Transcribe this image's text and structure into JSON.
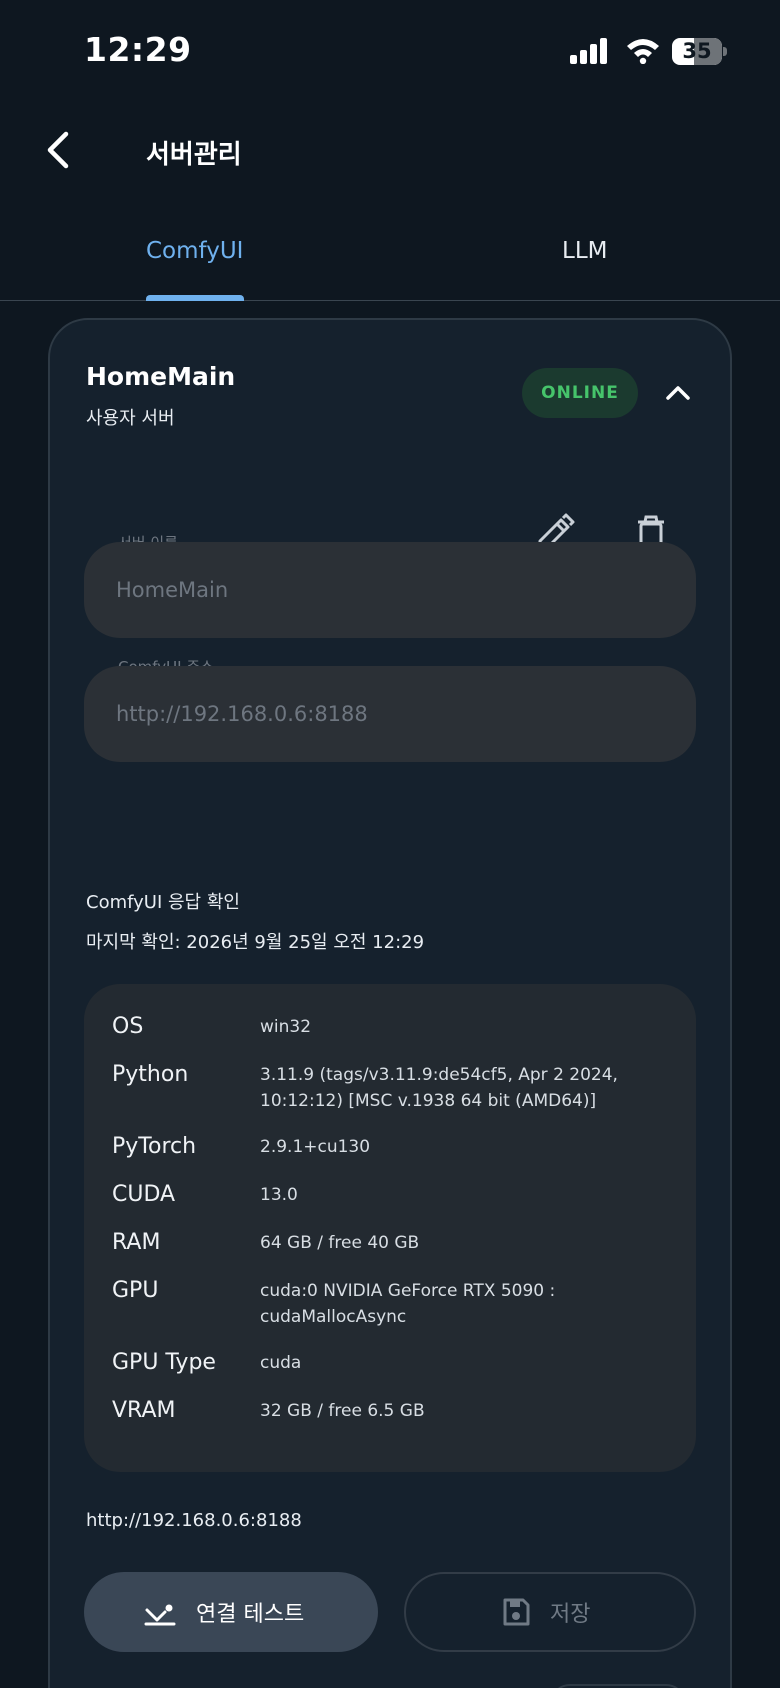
{
  "status_bar": {
    "time": "12:29",
    "battery": "35"
  },
  "header": {
    "title": "서버관리"
  },
  "tabs": [
    {
      "label": "ComfyUI",
      "active": true
    },
    {
      "label": "LLM",
      "active": false
    }
  ],
  "server": {
    "name": "HomeMain",
    "subtitle": "사용자 서버",
    "status": "ONLINE",
    "fields": {
      "name_label": "서버 이름",
      "name_value": "HomeMain",
      "url_label": "ComfyUI 주소",
      "url_value": "http://192.168.0.6:8188"
    },
    "check": {
      "title": "ComfyUI 응답 확인",
      "last_checked": "마지막 확인: 2026년 9월 25일 오전 12:29"
    },
    "info": [
      {
        "key": "OS",
        "value": "win32"
      },
      {
        "key": "Python",
        "value": "3.11.9 (tags/v3.11.9:de54cf5, Apr  2 2024, 10:12:12) [MSC v.1938 64 bit (AMD64)]"
      },
      {
        "key": "PyTorch",
        "value": "2.9.1+cu130"
      },
      {
        "key": "CUDA",
        "value": "13.0"
      },
      {
        "key": "RAM",
        "value": "64 GB / free 40 GB"
      },
      {
        "key": "GPU",
        "value": "cuda:0 NVIDIA GeForce RTX 5090 : cudaMallocAsync"
      },
      {
        "key": "GPU Type",
        "value": "cuda"
      },
      {
        "key": "VRAM",
        "value": "32 GB / free 6.5 GB"
      }
    ],
    "footer_url": "http://192.168.0.6:8188",
    "buttons": {
      "test_label": "연결 테스트",
      "save_label": "저장"
    }
  },
  "colors": {
    "accent": "#6fb1ee",
    "online": "#46c46b",
    "background": "#0e1720",
    "card": "#15212d"
  },
  "icons": [
    "back-chevron-icon",
    "chevron-up-icon",
    "pencil-icon",
    "trash-icon",
    "connection-test-icon",
    "floppy-disk-icon",
    "signal-icon",
    "wifi-icon",
    "battery-icon"
  ]
}
